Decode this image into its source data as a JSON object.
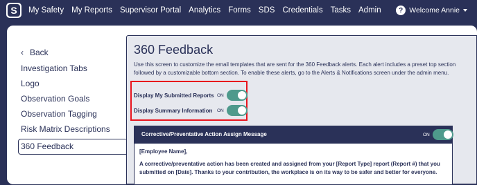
{
  "nav": {
    "logo_letter": "S",
    "links": [
      "My Safety",
      "My Reports",
      "Supervisor Portal",
      "Analytics",
      "Forms",
      "SDS",
      "Credentials",
      "Tasks",
      "Admin"
    ],
    "help_glyph": "?",
    "user_label": "Welcome Annie"
  },
  "sidebar": {
    "back_label": "Back",
    "items": [
      "Investigation Tabs",
      "Logo",
      "Observation Goals",
      "Observation Tagging",
      "Risk Matrix Descriptions",
      "360 Feedback"
    ],
    "active_index": 5
  },
  "content": {
    "title": "360 Feedback",
    "description": "Use this screen to customize the email templates that are sent for the 360 Feedback alerts. Each alert includes a preset top section followed by a customizable bottom section. To enable these alerts, go to the Alerts & Notifications screen under the admin menu.",
    "toggles": [
      {
        "label": "Display My Submitted Reports",
        "state_label": "ON",
        "on": true
      },
      {
        "label": "Display Summary Information",
        "state_label": "ON",
        "on": true
      }
    ],
    "alert": {
      "title": "Corrective/Preventative Action Assign Message",
      "state_label": "ON",
      "on": true,
      "greeting": "[Employee Name],",
      "body": "A corrective/preventative action has been created and assigned from your [Report Type] report (Report #) that you submitted on [Date]. Thanks to your contribution, the workplace is on its way to be safer and better for everyone."
    }
  },
  "colors": {
    "navy": "#2a3158",
    "toggle_on": "#4e9a8c",
    "highlight": "#e8141d",
    "panel_bg": "#e6e8ee"
  },
  "icons": [
    "logo-icon",
    "help-icon",
    "chevron-down-icon",
    "chevron-left-icon"
  ]
}
